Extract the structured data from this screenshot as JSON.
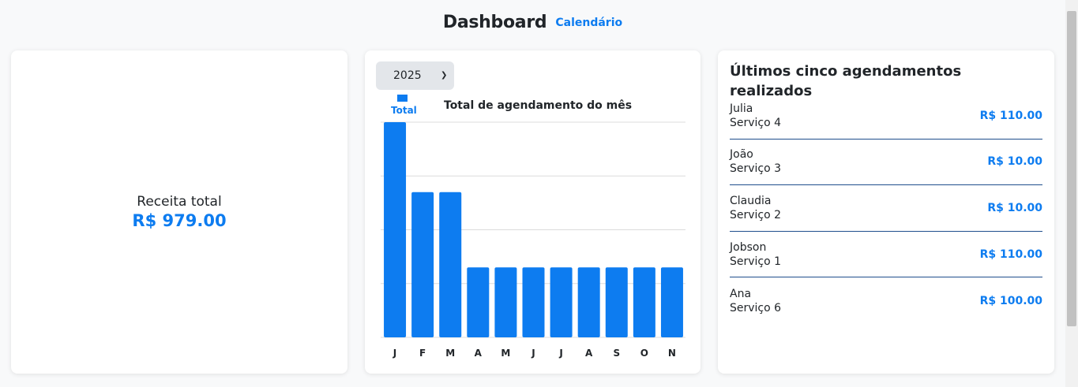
{
  "header": {
    "title": "Dashboard",
    "nav_link": "Calendário"
  },
  "revenue": {
    "label": "Receita total",
    "value": "R$ 979.00"
  },
  "chart_panel": {
    "year_selected": "2025",
    "legend_label": "Total",
    "title": "Total de agendamento do mês"
  },
  "chart_data": {
    "type": "bar",
    "title": "Total de agendamento do mês",
    "categories": [
      "J",
      "F",
      "M",
      "A",
      "M",
      "J",
      "J",
      "A",
      "S",
      "O",
      "N"
    ],
    "series": [
      {
        "name": "Total",
        "values": [
          4,
          2.7,
          2.7,
          1.3,
          1.3,
          1.3,
          1.3,
          1.3,
          1.3,
          1.3,
          1.3
        ]
      }
    ],
    "ylim": [
      0,
      4
    ],
    "grid": true,
    "legend": "top-left",
    "color": "#0d7cf0"
  },
  "appointments": {
    "title": "Últimos cinco agendamentos realizados",
    "items": [
      {
        "name": "Julia",
        "service": "Serviço 4",
        "price": "R$ 110.00"
      },
      {
        "name": "João",
        "service": "Serviço 3",
        "price": "R$ 10.00"
      },
      {
        "name": "Claudia",
        "service": "Serviço 2",
        "price": "R$ 10.00"
      },
      {
        "name": "Jobson",
        "service": "Serviço 1",
        "price": "R$ 110.00"
      },
      {
        "name": "Ana",
        "service": "Serviço 6",
        "price": "R$ 100.00"
      }
    ]
  },
  "colors": {
    "accent": "#0d7cf0",
    "background": "#f8f9fa",
    "divider": "#1f4e8c"
  }
}
